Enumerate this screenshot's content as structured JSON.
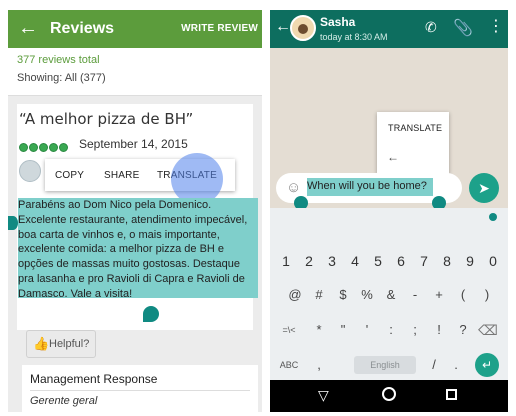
{
  "left_app": {
    "title": "Reviews",
    "write_review": "WRITE REVIEW",
    "reviews_total": "377 reviews total",
    "showing": "Showing: All (377)",
    "review": {
      "title": "“A melhor pizza de BH”",
      "date": "September 14, 2015",
      "rating_stars": 5,
      "text": "Parabéns ao Dom Nico pela Domenico. Excelente restaurante, atendimento impecável, boa carta de vinhos e, o mais importante, excelente comida: a melhor pizza de BH e opções de massas muito gostosas. Destaque pra lasanha e pro Ravioli di Capra e Ravioli de Damasco. Vale a visita!"
    },
    "context_menu": {
      "copy": "COPY",
      "share": "SHARE",
      "translate": "TRANSLATE"
    },
    "helpful": "Helpful?",
    "management": {
      "title": "Management Response",
      "role": "Gerente geral"
    },
    "colors": {
      "appbar": "#5c9c3c",
      "selection": "#7fcfcb",
      "handle": "#108a82"
    }
  },
  "right_app": {
    "contact_name": "Sasha",
    "last_seen": "today at 8:30 AM",
    "translate_popup": "TRANSLATE",
    "compose_text": "When will you be home?",
    "keyboard": {
      "numbers": [
        "1",
        "2",
        "3",
        "4",
        "5",
        "6",
        "7",
        "8",
        "9",
        "0"
      ],
      "row2": [
        "@",
        "#",
        "$",
        "%",
        "&",
        "-",
        "+",
        "(",
        ")"
      ],
      "row3": [
        "=\\<",
        "*",
        "\"",
        "'",
        ":",
        ";",
        "!",
        "?"
      ],
      "bottom": {
        "abc": "ABC",
        "comma": ",",
        "space": "English",
        "slash": "/",
        "period": "."
      }
    },
    "colors": {
      "appbar": "#0d6e5f",
      "accent": "#1da18a",
      "selection": "#7fcfcb"
    },
    "icons": {
      "call": "call-icon",
      "attach": "paperclip-icon",
      "menu": "more-vert-icon",
      "emoji": "smiley-icon",
      "send": "send-icon"
    }
  }
}
